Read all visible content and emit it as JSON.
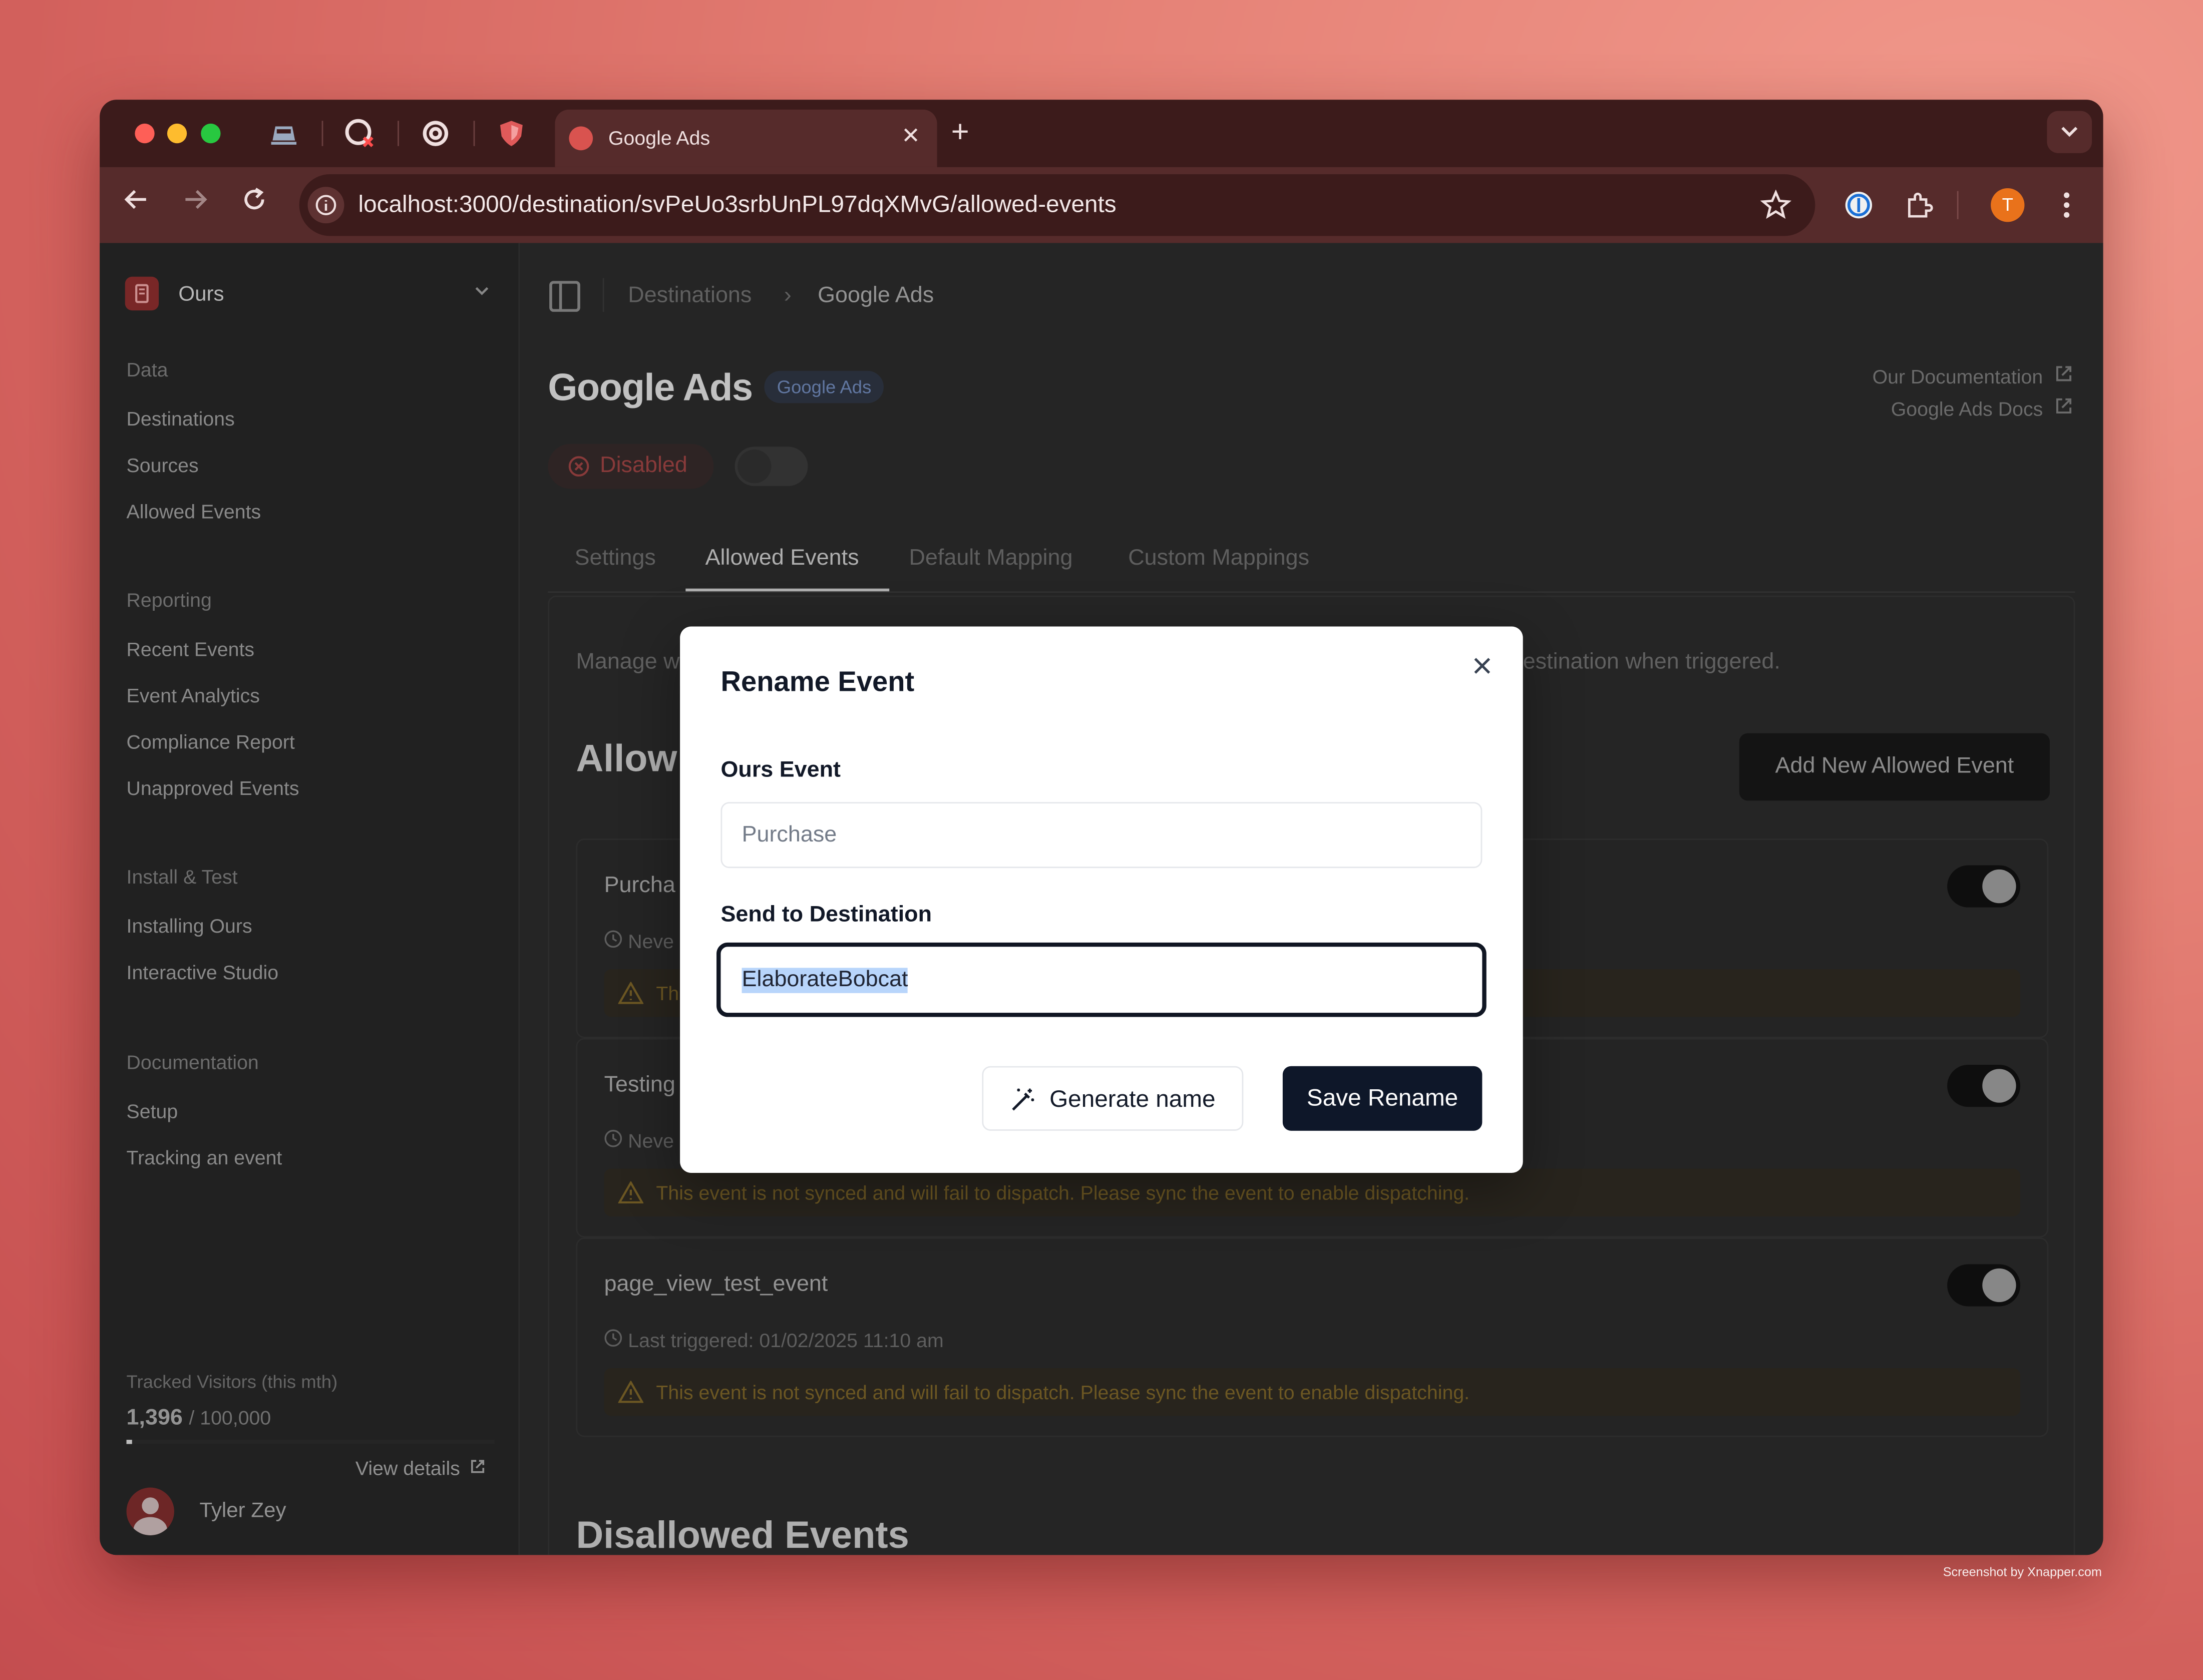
{
  "browser": {
    "tabs": [
      {
        "name": "pinned-tab-1",
        "icon": "train-icon"
      },
      {
        "name": "pinned-tab-2",
        "icon": "github-error-icon"
      },
      {
        "name": "pinned-tab-3",
        "icon": "radar-icon"
      },
      {
        "name": "pinned-tab-4",
        "icon": "shield-icon"
      }
    ],
    "active_tab": {
      "title": "Google Ads",
      "favicon_color": "#d9534f",
      "close_glyph": "✕"
    },
    "new_tab_glyph": "+",
    "url": "localhost:3000/destination/svPeUo3srbUnPL97dqXMvG/allowed-events",
    "profile_initial": "T",
    "profile_color": "#e9721b"
  },
  "sidebar": {
    "workspace": "Ours",
    "groups": [
      {
        "label": "Data",
        "items": [
          "Destinations",
          "Sources",
          "Allowed Events"
        ]
      },
      {
        "label": "Reporting",
        "items": [
          "Recent Events",
          "Event Analytics",
          "Compliance Report",
          "Unapproved Events"
        ]
      },
      {
        "label": "Install & Test",
        "items": [
          "Installing Ours",
          "Interactive Studio"
        ]
      },
      {
        "label": "Documentation",
        "items": [
          "Setup",
          "Tracking an event"
        ]
      }
    ],
    "usage": {
      "label": "Tracked Visitors (this mth)",
      "count": "1,396",
      "limit": "/ 100,000",
      "fraction": 0.014
    },
    "view_details": "View details",
    "user": "Tyler Zey"
  },
  "header": {
    "breadcrumb": [
      "Destinations",
      "Google Ads"
    ],
    "title": "Google Ads",
    "badge": "Google Ads",
    "links": [
      "Our Documentation",
      "Google Ads Docs"
    ],
    "status": "Disabled",
    "tabs": [
      "Settings",
      "Allowed Events",
      "Default Mapping",
      "Custom Mappings"
    ],
    "active_tab": "Allowed Events"
  },
  "content": {
    "desc_left": "Manage w",
    "desc_right": "estination when triggered.",
    "section_title": "Allow",
    "add_button": "Add New Allowed Event",
    "events": [
      {
        "name": "Purcha",
        "triggered": "Neve",
        "warning": "Th"
      },
      {
        "name": "Testing",
        "triggered": "Neve",
        "warning": "This event is not synced and will fail to dispatch. Please sync the event to enable dispatching."
      },
      {
        "name": "page_view_test_event",
        "triggered": "Last triggered: 01/02/2025 11:10 am",
        "warning": "This event is not synced and will fail to dispatch. Please sync the event to enable dispatching."
      }
    ],
    "disallowed_title": "Disallowed Events"
  },
  "modal": {
    "title": "Rename Event",
    "source_label": "Ours Event",
    "source_value": "Purchase",
    "dest_label": "Send to Destination",
    "dest_value": "ElaborateBobcat",
    "generate_button": "Generate name",
    "save_button": "Save Rename"
  },
  "credit": "Screenshot by Xnapper.com"
}
